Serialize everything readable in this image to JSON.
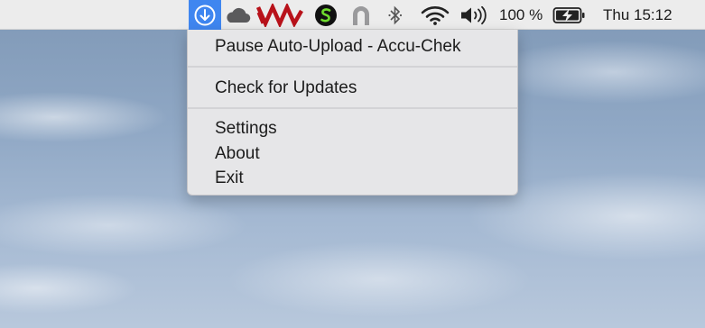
{
  "menubar": {
    "icons": [
      "download-arrow-icon",
      "cloud-icon",
      "zigzag-app-icon",
      "green-s-app-icon",
      "arch-app-icon",
      "bluetooth-icon",
      "wifi-icon",
      "volume-icon",
      "battery-charging-icon"
    ],
    "battery_percent": "100 %",
    "clock": "Thu 15:12",
    "active_color": "#3f86f0"
  },
  "menu": {
    "items": [
      {
        "label": "Pause Auto-Upload - Accu-Chek"
      },
      {
        "label": "Check for Updates"
      },
      {
        "label": "Settings"
      },
      {
        "label": "About"
      },
      {
        "label": "Exit"
      }
    ]
  }
}
